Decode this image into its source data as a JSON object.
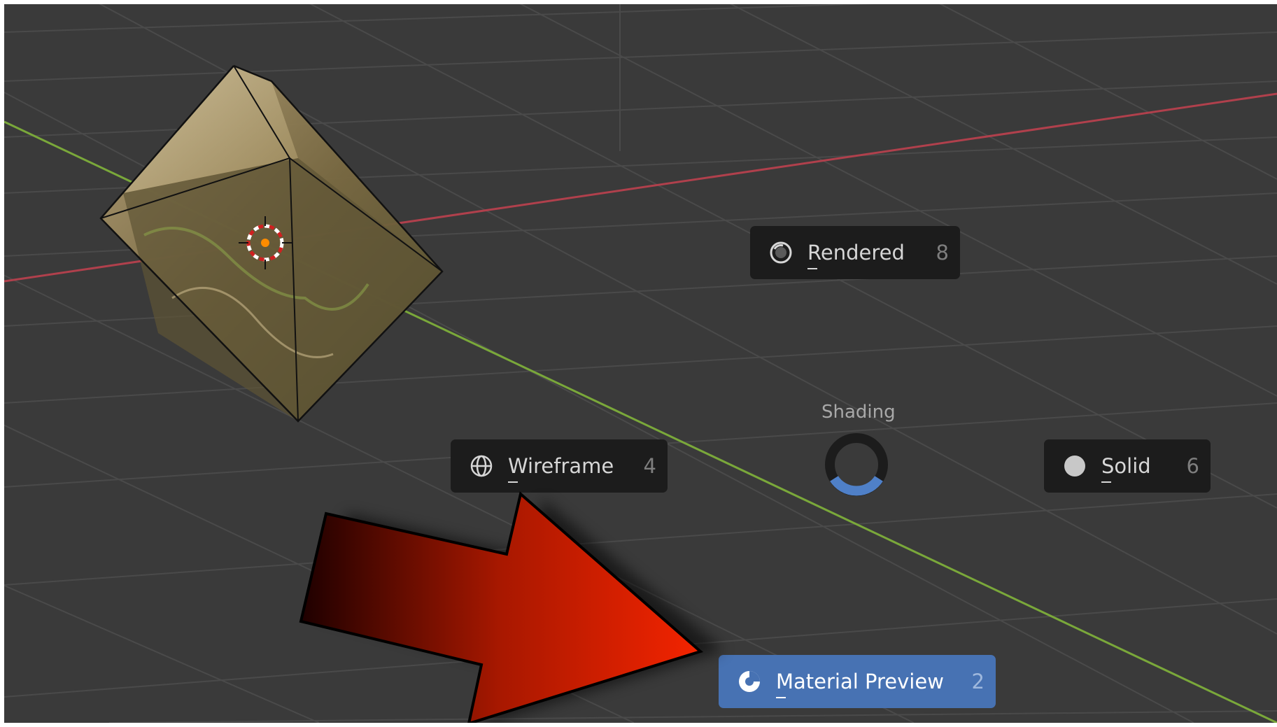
{
  "pie_menu": {
    "title": "Shading",
    "items": [
      {
        "label": "Rendered",
        "shortcut": "8",
        "icon": "rendered-sphere-icon"
      },
      {
        "label": "Wireframe",
        "shortcut": "4",
        "icon": "wireframe-globe-icon"
      },
      {
        "label": "Solid",
        "shortcut": "6",
        "icon": "solid-circle-icon"
      },
      {
        "label": "Material Preview",
        "shortcut": "2",
        "icon": "material-preview-sphere-icon",
        "active": true
      }
    ]
  },
  "colors": {
    "viewport_bg": "#3a3a3a",
    "grid": "#4a4a4a",
    "x_axis": "#b0404c",
    "y_axis": "#7aa83a",
    "menu_bg": "#1c1c1c",
    "active_bg": "#4772b3",
    "annotation_arrow": "#ee2200"
  }
}
